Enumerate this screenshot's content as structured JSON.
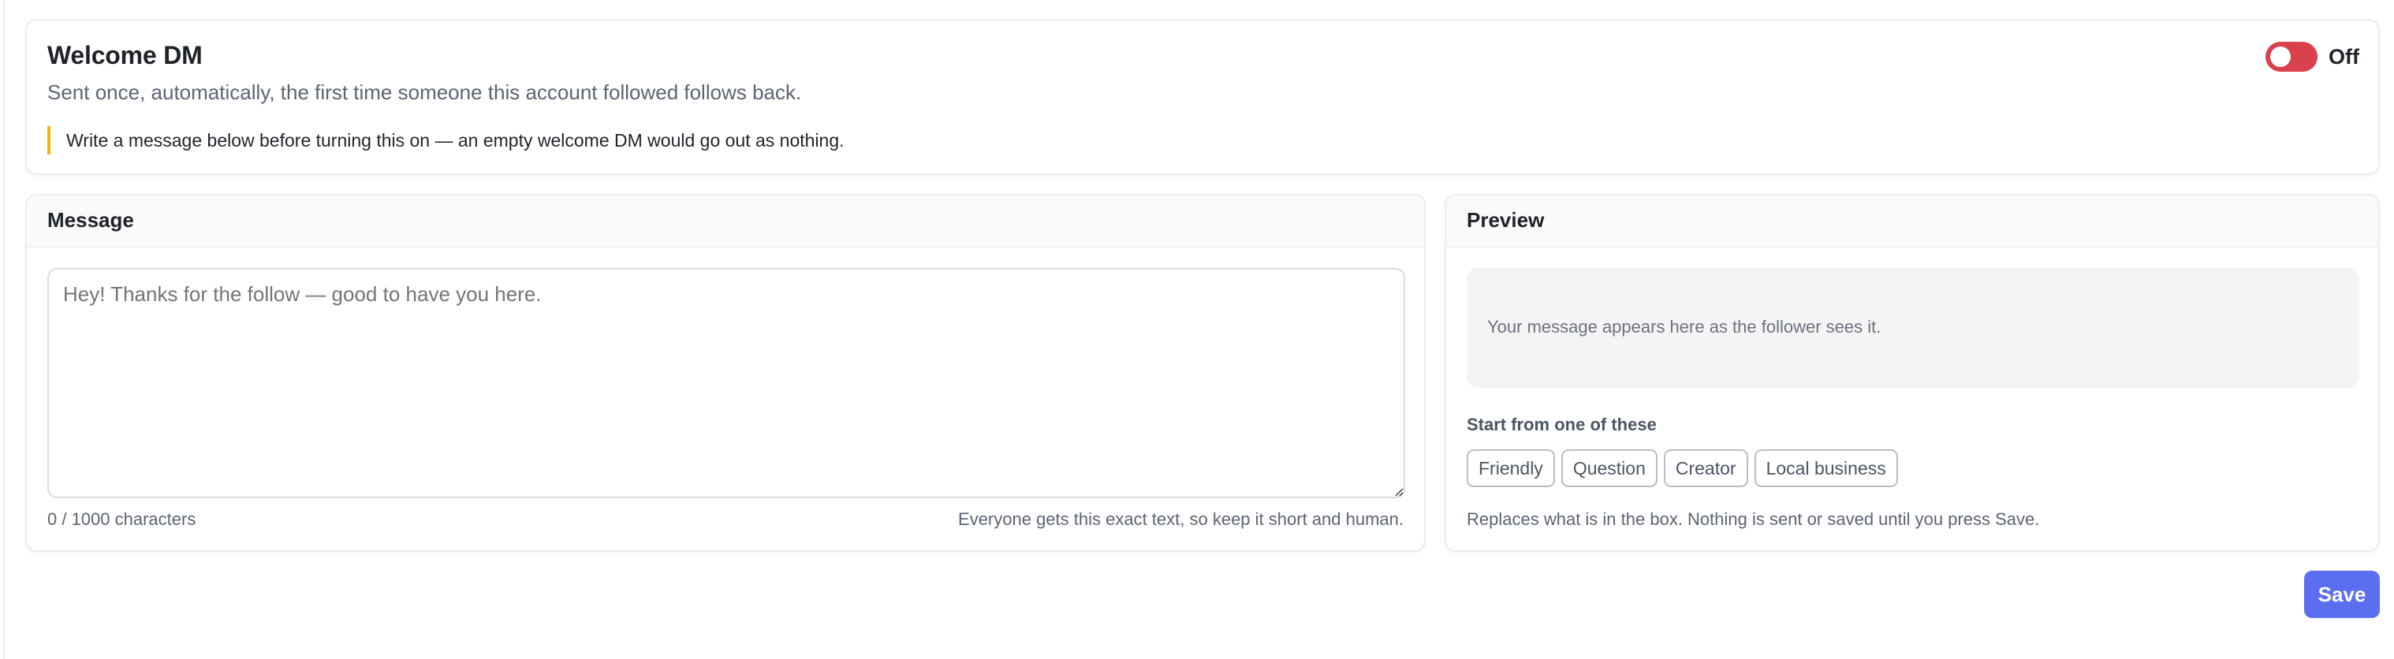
{
  "header": {
    "title": "Welcome DM",
    "subtitle": "Sent once, automatically, the first time someone this account followed follows back.",
    "warning": "Write a message below before turning this on — an empty welcome DM would go out as nothing.",
    "toggle_state": "Off",
    "toggle_color": "#d9414c"
  },
  "message": {
    "section_title": "Message",
    "placeholder": "Hey! Thanks for the follow — good to have you here.",
    "value": "",
    "char_count": "0 / 1000 characters",
    "hint": "Everyone gets this exact text, so keep it short and human."
  },
  "preview": {
    "section_title": "Preview",
    "placeholder": "Your message appears here as the follower sees it.",
    "templates_label": "Start from one of these",
    "templates": [
      {
        "label": "Friendly"
      },
      {
        "label": "Question"
      },
      {
        "label": "Creator"
      },
      {
        "label": "Local business"
      }
    ],
    "templates_note": "Replaces what is in the box. Nothing is sent or saved until you press Save."
  },
  "actions": {
    "save_label": "Save",
    "save_color": "#5b6ef0"
  }
}
